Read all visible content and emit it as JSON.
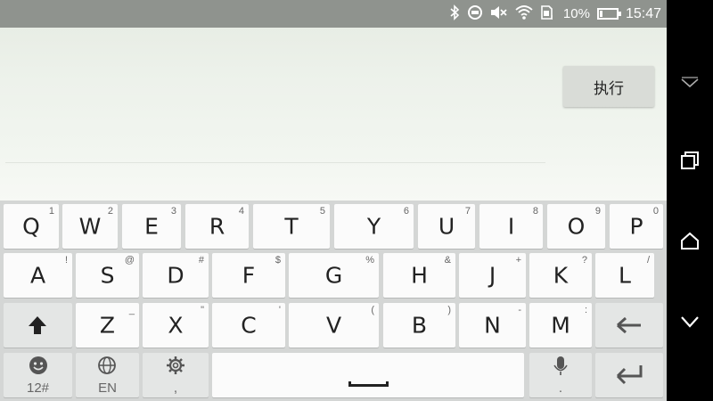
{
  "status_bar": {
    "bluetooth_icon": "bluetooth-icon",
    "sync_icon": "sync-icon",
    "mute_icon": "mute-icon",
    "wifi_icon": "wifi-icon",
    "sim_icon": "sim-icon",
    "battery_percent": "10%",
    "time": "15:47"
  },
  "app": {
    "execute_label": "执行"
  },
  "keyboard": {
    "row1": [
      {
        "label": "Q",
        "hint": "1"
      },
      {
        "label": "W",
        "hint": "2"
      },
      {
        "label": "E",
        "hint": "3"
      },
      {
        "label": "R",
        "hint": "4"
      },
      {
        "label": "T",
        "hint": "5"
      },
      {
        "label": "Y",
        "hint": "6"
      },
      {
        "label": "U",
        "hint": "7"
      },
      {
        "label": "I",
        "hint": "8"
      },
      {
        "label": "O",
        "hint": "9"
      },
      {
        "label": "P",
        "hint": "0"
      }
    ],
    "row2": [
      {
        "label": "A",
        "hint": "!"
      },
      {
        "label": "S",
        "hint": "@"
      },
      {
        "label": "D",
        "hint": "#"
      },
      {
        "label": "F",
        "hint": "$"
      },
      {
        "label": "G",
        "hint": "%"
      },
      {
        "label": "H",
        "hint": "&"
      },
      {
        "label": "J",
        "hint": "+"
      },
      {
        "label": "K",
        "hint": "?"
      },
      {
        "label": "L",
        "hint": "/"
      }
    ],
    "row3": [
      {
        "label": "Z",
        "hint": "_"
      },
      {
        "label": "X",
        "hint": "\""
      },
      {
        "label": "C",
        "hint": "'"
      },
      {
        "label": "V",
        "hint": "("
      },
      {
        "label": "B",
        "hint": ")"
      },
      {
        "label": "N",
        "hint": "-"
      },
      {
        "label": "M",
        "hint": ":"
      }
    ],
    "shift_icon": "shift-arrow-icon",
    "backspace_icon": "backspace-icon",
    "emoji_key": {
      "icon": "emoji-icon",
      "label": "12#"
    },
    "language_key": {
      "icon": "globe-icon",
      "label": "EN"
    },
    "settings_key": {
      "icon": "gear-icon",
      "label": ","
    },
    "voice_key": {
      "icon": "microphone-icon",
      "label": "."
    },
    "enter_icon": "enter-icon"
  },
  "nav_bar": {
    "hide_icon": "chevron-down-icon",
    "recent_icon": "recent-apps-icon",
    "home_icon": "home-icon",
    "back_icon": "back-icon"
  },
  "colors": {
    "status_bar": "#8f938e",
    "keyboard_bg": "#d4d6d5",
    "key_bg": "#fbfbfb",
    "func_key_bg": "#e4e6e5",
    "button_bg": "#d9dcd7"
  }
}
